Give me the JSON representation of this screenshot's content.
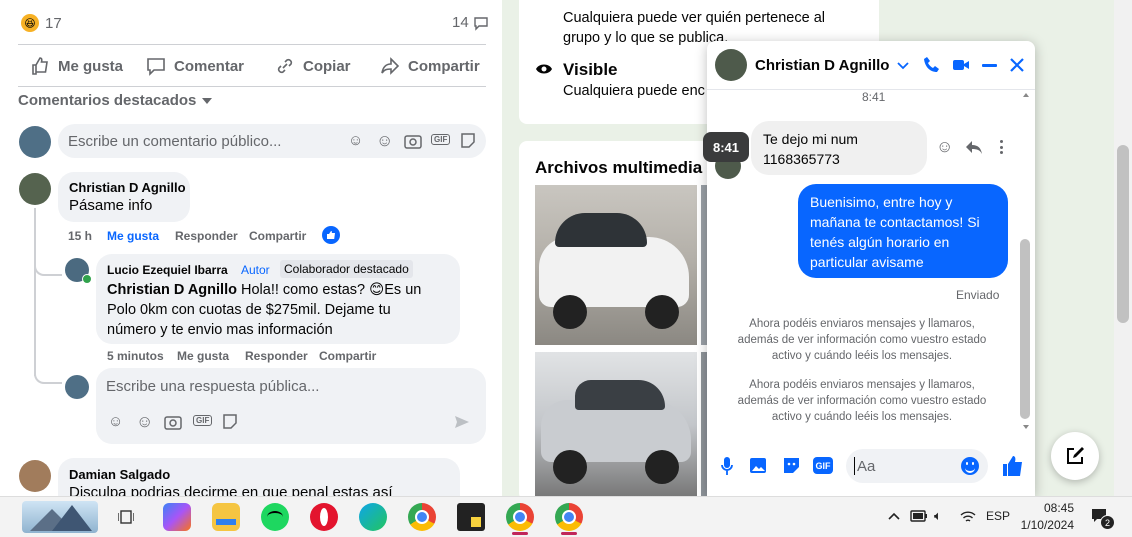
{
  "feed": {
    "reaction_count": "17",
    "comment_count": "14",
    "actions": {
      "like": "Me gusta",
      "comment": "Comentar",
      "copy": "Copiar",
      "share": "Compartir"
    },
    "filter_label": "Comentarios destacados",
    "comment_placeholder": "Escribe un comentario público...",
    "comments": [
      {
        "author": "Christian D Agnillo",
        "text": "Pásame info",
        "time": "15 h",
        "like": "Me gusta",
        "reply": "Responder",
        "share": "Compartir"
      }
    ],
    "reply": {
      "author": "Lucio Ezequiel Ibarra",
      "badge_author": "Autor",
      "badge_featured": "Colaborador destacado",
      "mention": "Christian D Agnillo",
      "text_line1": " Hola!! como estas? 😊Es un",
      "text_line2": "Polo 0km con cuotas de $275mil. Dejame tu",
      "text_line3": "número y te envio mas información",
      "time": "5 minutos",
      "like": "Me gusta",
      "reply": "Responder",
      "share": "Compartir"
    },
    "reply_placeholder": "Escribe una respuesta pública...",
    "next_comment": {
      "author": "Damian Salgado",
      "text": "Disculpa podrias decirme en que penal estas así"
    }
  },
  "group_info": {
    "privacy_line1": "Cualquiera puede ver quién pertenece al",
    "privacy_line2": "grupo y lo que se publica.",
    "visible_title": "Visible",
    "visible_desc": "Cualquiera puede enc"
  },
  "media": {
    "title": "Archivos multimedia re"
  },
  "chat": {
    "name": "Christian D Agnillo",
    "time_top": "8:41",
    "tooltip_time": "8:41",
    "incoming_line1": "Te dejo mi num",
    "incoming_line2": "1168365773",
    "outgoing": [
      "Buenisimo, entre hoy y",
      "mañana te contactamos! Si",
      "tenés algún horario en",
      "particular avisame"
    ],
    "status": "Enviado",
    "system_msg_1": [
      "Ahora podéis enviaros mensajes y llamaros,",
      "además de ver información como vuestro estado",
      "activo y cuándo leéis los mensajes."
    ],
    "system_msg_2": [
      "Ahora podéis enviaros mensajes y llamaros,",
      "además de ver información como vuestro estado",
      "activo y cuándo leéis los mensajes."
    ],
    "input_placeholder": "Aa",
    "colors": {
      "accent": "#0866ff",
      "bubble_in": "#f0f0f0"
    }
  },
  "taskbar": {
    "lang": "ESP",
    "time": "08:45",
    "date": "1/10/2024",
    "notifications": "2"
  }
}
